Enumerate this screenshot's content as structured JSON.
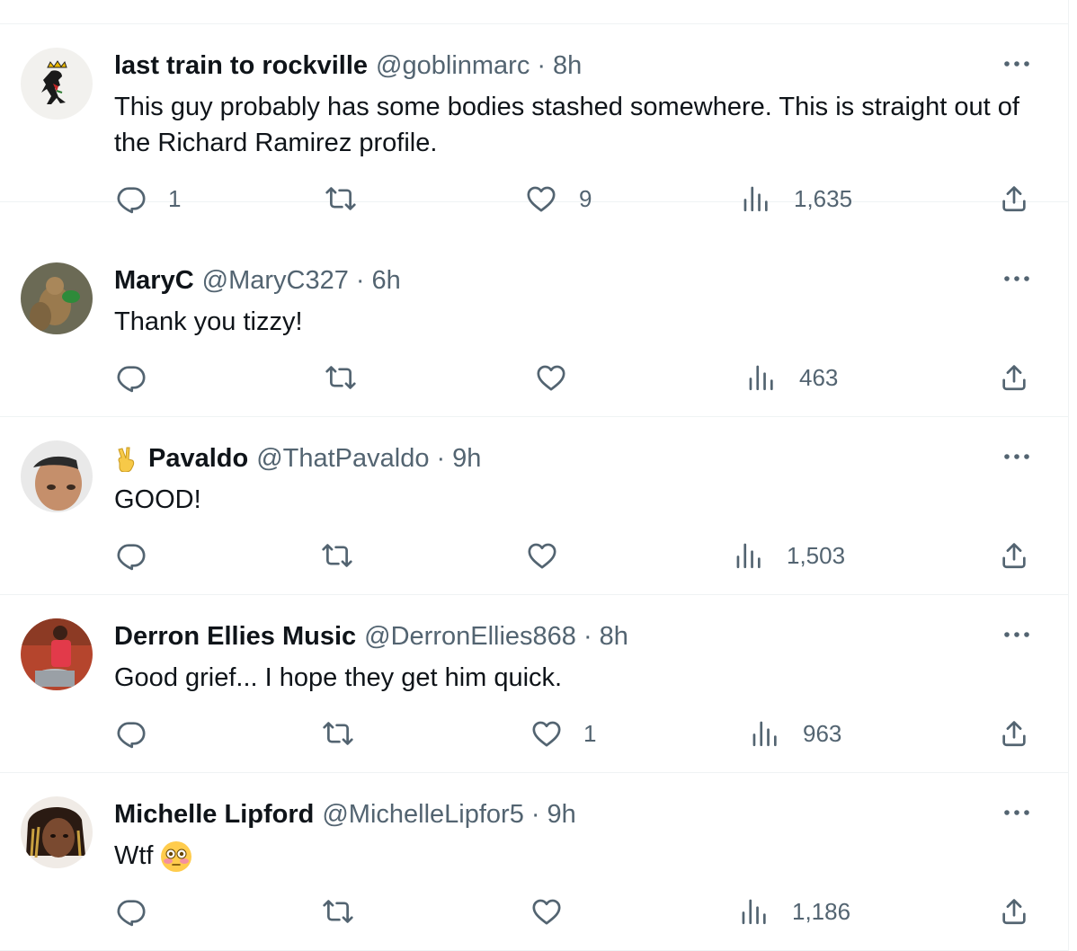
{
  "tweets": [
    {
      "name": "last train to rockville",
      "handle": "@goblinmarc",
      "time": "8h",
      "text": "This guy probably has some bodies stashed somewhere.  This is straight out of the Richard Ramirez profile.",
      "replies": "1",
      "retweets": "",
      "likes": "9",
      "views": "1,635"
    },
    {
      "name": "MaryC",
      "handle": "@MaryC327",
      "time": "6h",
      "text": "Thank you tizzy!",
      "replies": "",
      "retweets": "",
      "likes": "",
      "views": "463"
    },
    {
      "name": "Pavaldo",
      "name_emoji": "victory-hand-emoji",
      "handle": "@ThatPavaldo",
      "time": "9h",
      "text": "GOOD!",
      "replies": "",
      "retweets": "",
      "likes": "",
      "views": "1,503"
    },
    {
      "name": "Derron Ellies Music",
      "handle": "@DerronEllies868",
      "time": "8h",
      "text": "Good grief... I hope they get him quick.",
      "replies": "",
      "retweets": "",
      "likes": "1",
      "views": "963"
    },
    {
      "name": "Michelle Lipford",
      "handle": "@MichelleLipfor5",
      "time": "9h",
      "text": "Wtf",
      "text_emoji": "flushed-face-emoji",
      "replies": "",
      "retweets": "",
      "likes": "",
      "views": "1,186"
    }
  ],
  "separator": "·",
  "icons": {
    "reply": "reply-icon",
    "retweet": "retweet-icon",
    "like": "heart-icon",
    "views": "views-icon",
    "share": "share-icon",
    "more": "more-icon"
  },
  "colors": {
    "text": "#0f1419",
    "secondary": "#536471",
    "border": "#eff3f4"
  }
}
